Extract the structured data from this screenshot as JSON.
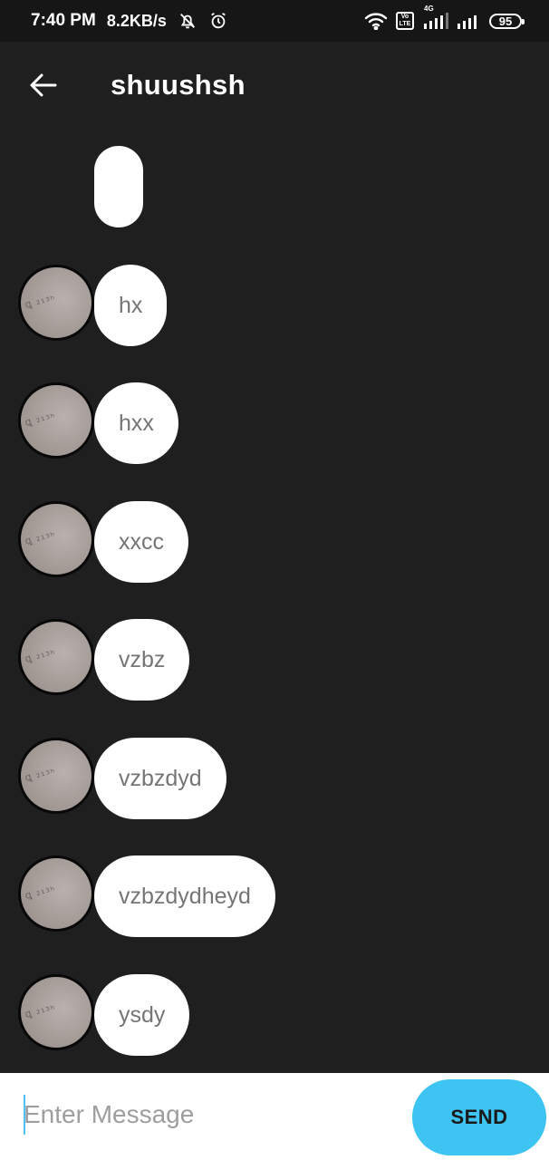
{
  "status_bar": {
    "time": "7:40 PM",
    "network_speed": "8.2KB/s",
    "volte_top": "Vo",
    "volte_bottom": "LTE",
    "network_type": "4G",
    "battery": "95",
    "icons": [
      "mute-icon",
      "alarm-icon",
      "wifi-icon",
      "volte-icon",
      "signal-icon",
      "signal-icon",
      "battery-icon"
    ]
  },
  "app_bar": {
    "title": "shuushsh",
    "back_icon": "arrow-left-icon"
  },
  "messages": [
    {
      "text": "",
      "has_avatar": false
    },
    {
      "text": "hx",
      "has_avatar": true
    },
    {
      "text": "hxx",
      "has_avatar": true
    },
    {
      "text": "xxcc",
      "has_avatar": true
    },
    {
      "text": "vzbz",
      "has_avatar": true
    },
    {
      "text": "vzbzdyd",
      "has_avatar": true
    },
    {
      "text": "vzbzdydheyd",
      "has_avatar": true
    },
    {
      "text": "ysdy",
      "has_avatar": true
    }
  ],
  "composer": {
    "placeholder": "Enter Message",
    "value": "",
    "send_label": "SEND",
    "send_color": "#3ec4f3",
    "cursor_color": "#4fc3f7"
  },
  "colors": {
    "background": "#1f1f1f",
    "status_bar": "#161616",
    "bubble": "#ffffff",
    "bubble_text": "#757575"
  }
}
